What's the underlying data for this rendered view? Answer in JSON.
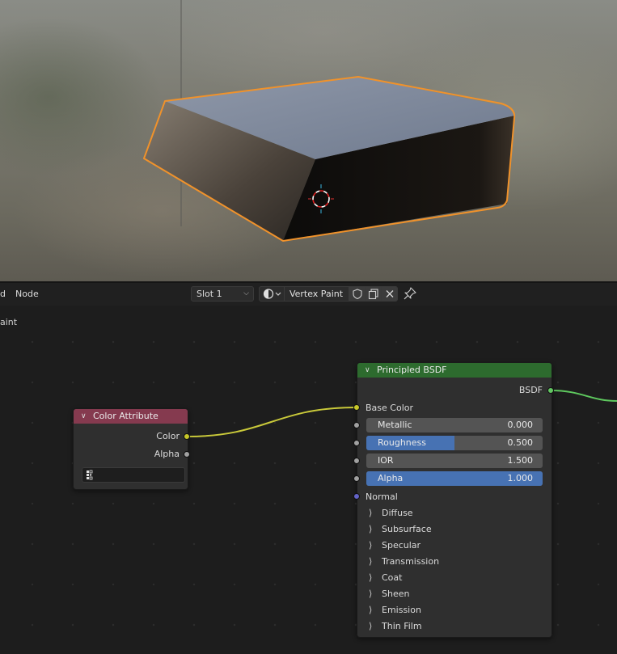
{
  "header": {
    "left_cut_label": "d",
    "node_menu": "Node",
    "slot": "Slot 1",
    "material_name": "Vertex Paint"
  },
  "sub_label": "aint",
  "nodes": {
    "color_attribute": {
      "title": "Color Attribute",
      "header_color": "#853a4f",
      "outputs": [
        "Color",
        "Alpha"
      ]
    },
    "principled_bsdf": {
      "title": "Principled BSDF",
      "header_color": "#2d6b2e",
      "output": "BSDF",
      "inputs": {
        "base_color": "Base Color",
        "normal": "Normal"
      },
      "fields": [
        {
          "label": "Metallic",
          "value": "0.000",
          "fraction": 0.0
        },
        {
          "label": "Roughness",
          "value": "0.500",
          "fraction": 0.5
        },
        {
          "label": "IOR",
          "value": "1.500",
          "fraction": 0.0
        },
        {
          "label": "Alpha",
          "value": "1.000",
          "fraction": 1.0
        }
      ],
      "panels": [
        "Diffuse",
        "Subsurface",
        "Specular",
        "Transmission",
        "Coat",
        "Sheen",
        "Emission",
        "Thin Film"
      ]
    }
  },
  "colors": {
    "accent": "#4772b3",
    "selection_outline": "#f0922b",
    "socket_color": "#c7c729",
    "socket_float": "#a1a1a1",
    "socket_shader": "#63c763",
    "socket_vector": "#6363c7"
  },
  "icons": [
    "material-sphere-icon",
    "shield-icon",
    "duplicate-icon",
    "close-icon",
    "pin-icon",
    "chevron-down-icon",
    "chevron-right-icon",
    "attribute-icon"
  ]
}
